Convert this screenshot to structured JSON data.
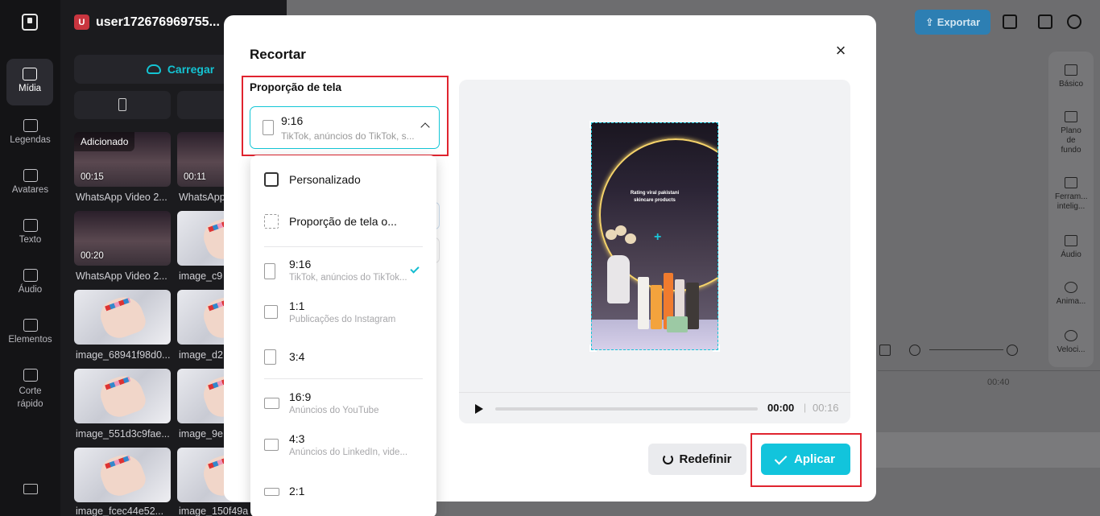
{
  "app": {
    "user_initial": "U",
    "username": "user172676969755..."
  },
  "rail": [
    {
      "label": "Mídia",
      "icon": "cloud-upload-icon"
    },
    {
      "label": "Legendas",
      "icon": "captions-icon"
    },
    {
      "label": "Avatares",
      "icon": "avatar-icon"
    },
    {
      "label": "Texto",
      "icon": "text-icon"
    },
    {
      "label": "Áudio",
      "icon": "music-icon"
    },
    {
      "label": "Elementos",
      "icon": "elements-icon"
    },
    {
      "label": "Corte rápido",
      "icon": "quick-cut-icon"
    }
  ],
  "media": {
    "upload_label": "Carregar",
    "items": [
      {
        "name": "WhatsApp Video 2...",
        "duration": "00:15",
        "tag": "Adicionado"
      },
      {
        "name": "WhatsApp",
        "duration": "00:11",
        "tag": ""
      },
      {
        "name": "WhatsApp Video 2...",
        "duration": "00:20",
        "tag": ""
      },
      {
        "name": "image_c9",
        "duration": "",
        "tag": ""
      },
      {
        "name": "image_68941f98d0...",
        "duration": "",
        "tag": ""
      },
      {
        "name": "image_d2",
        "duration": "",
        "tag": ""
      },
      {
        "name": "image_551d3c9fae...",
        "duration": "",
        "tag": ""
      },
      {
        "name": "image_9e",
        "duration": "",
        "tag": ""
      },
      {
        "name": "image_fcec44e52...",
        "duration": "",
        "tag": ""
      },
      {
        "name": "image_150f49a",
        "duration": "",
        "tag": ""
      }
    ]
  },
  "toolbar": {
    "export_label": "Exportar"
  },
  "right_panel": [
    {
      "label": "Básico",
      "icon": "basic-icon"
    },
    {
      "label": "Plano de fundo",
      "icon": "background-icon"
    },
    {
      "label": "Ferram... intelig...",
      "icon": "magic-wand-icon"
    },
    {
      "label": "Áudio",
      "icon": "music-icon"
    },
    {
      "label": "Anima...",
      "icon": "animation-icon"
    },
    {
      "label": "Veloci...",
      "icon": "speed-icon"
    }
  ],
  "timeline": {
    "marker": "00:40"
  },
  "dialog": {
    "title": "Recortar",
    "ratio_label": "Proporção de tela",
    "selected": {
      "ratio": "9:16",
      "desc": "TikTok, anúncios do TikTok, s..."
    },
    "options": [
      {
        "label": "Personalizado",
        "desc": "",
        "icon": "custom-crop-icon"
      },
      {
        "label": "Proporção de tela o...",
        "desc": "",
        "icon": "original-ratio-icon"
      },
      {
        "label": "9:16",
        "desc": "TikTok, anúncios do TikTok...",
        "icon": "ratio-9-16-icon",
        "selected": true
      },
      {
        "label": "1:1",
        "desc": "Publicações do Instagram",
        "icon": "ratio-1-1-icon"
      },
      {
        "label": "3:4",
        "desc": "",
        "icon": "ratio-3-4-icon"
      },
      {
        "label": "16:9",
        "desc": "Anúncios do YouTube",
        "icon": "ratio-16-9-icon"
      },
      {
        "label": "4:3",
        "desc": "Anúncios do LinkedIn, vide...",
        "icon": "ratio-4-3-icon"
      },
      {
        "label": "2:1",
        "desc": "",
        "icon": "ratio-2-1-icon"
      }
    ],
    "video_text": {
      "line1": "Rating viral pakistani",
      "line2": "skincare products"
    },
    "player": {
      "current": "00:00",
      "separator": "|",
      "duration": "00:16",
      "progress": 0
    },
    "reset_label": "Redefinir",
    "apply_label": "Aplicar"
  },
  "colors": {
    "accent": "#12c4dc",
    "highlight": "#e0242f"
  }
}
